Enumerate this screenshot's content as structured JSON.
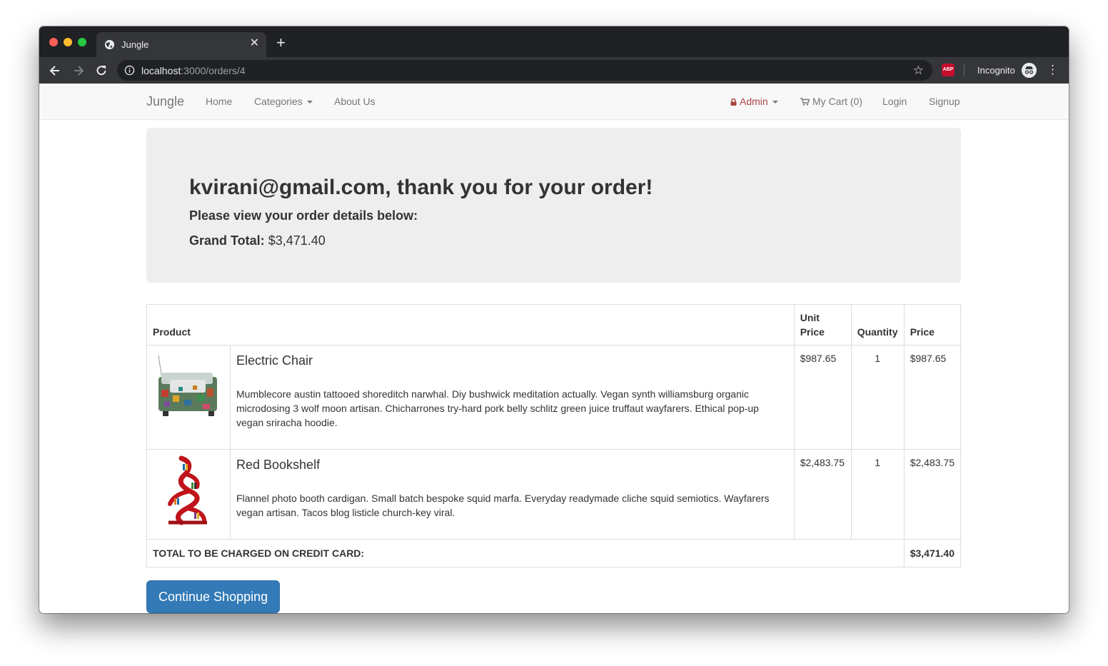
{
  "browser": {
    "tab_title": "Jungle",
    "url_host": "localhost",
    "url_path": ":3000/orders/4",
    "profile_label": "Incognito",
    "extension_label": "ABP"
  },
  "navbar": {
    "brand": "Jungle",
    "home": "Home",
    "categories": "Categories",
    "about": "About Us",
    "admin": "Admin",
    "cart": "My Cart (0)",
    "login": "Login",
    "signup": "Signup"
  },
  "hero": {
    "heading": "kvirani@gmail.com, thank you for your order!",
    "subheading": "Please view your order details below:",
    "grand_total_label": "Grand Total:",
    "grand_total_value": "$3,471.40"
  },
  "order_table": {
    "headers": {
      "product": "Product",
      "unit_price": "Unit Price",
      "quantity": "Quantity",
      "price": "Price"
    },
    "items": [
      {
        "name": "Electric Chair",
        "description": "Mumblecore austin tattooed shoreditch narwhal. Diy bushwick meditation actually. Vegan synth williamsburg organic microdosing 3 wolf moon artisan. Chicharrones try-hard pork belly schlitz green juice truffaut wayfarers. Ethical pop-up vegan sriracha hoodie.",
        "unit_price": "$987.65",
        "quantity": "1",
        "price": "$987.65"
      },
      {
        "name": "Red Bookshelf",
        "description": "Flannel photo booth cardigan. Small batch bespoke squid marfa. Everyday readymade cliche squid semiotics. Wayfarers vegan artisan. Tacos blog listicle church-key viral.",
        "unit_price": "$2,483.75",
        "quantity": "1",
        "price": "$2,483.75"
      }
    ],
    "total_label": "TOTAL TO BE CHARGED ON CREDIT CARD:",
    "total_value": "$3,471.40"
  },
  "actions": {
    "continue_shopping": "Continue Shopping"
  },
  "colors": {
    "primary_button": "#337ab7",
    "admin_link": "#a94442",
    "jumbotron_bg": "#eeeeee"
  }
}
